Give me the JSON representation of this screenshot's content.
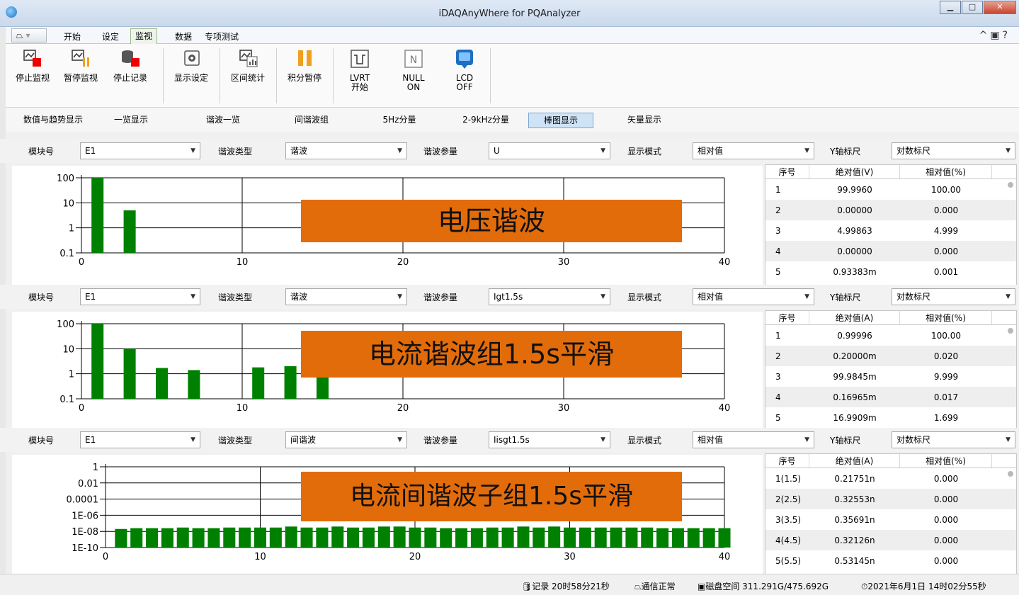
{
  "window": {
    "title": "iDAQAnyWhere for PQAnalyzer"
  },
  "ribbon": {
    "tabs": [
      "开始",
      "设定",
      "监视",
      "数据",
      "专项测试"
    ],
    "active_tab": "监视"
  },
  "toolbar": {
    "stop_monitor": "停止监视",
    "pause_monitor": "暂停监视",
    "stop_record": "停止记录",
    "display_settings": "显示设定",
    "interval_stats": "区间统计",
    "integral_pause": "积分暂停",
    "lvrt_line1": "LVRT",
    "lvrt_line2": "开始",
    "null_line1": "NULL",
    "null_line2": "ON",
    "lcd_line1": "LCD",
    "lcd_line2": "OFF",
    "null_icon_text": "N"
  },
  "subtabs": [
    "数值与趋势显示",
    "一览显示",
    "谐波一览",
    "间谐波组",
    "5Hz分量",
    "2-9kHz分量",
    "棒图显示",
    "矢量显示"
  ],
  "active_subtab": "棒图显示",
  "panels": [
    {
      "controls": {
        "module_label": "模块号",
        "module_value": "E1",
        "type_label": "谐波类型",
        "type_value": "谐波",
        "param_label": "谐波参量",
        "param_value": "U",
        "mode_label": "显示模式",
        "mode_value": "相对值",
        "yscale_label": "Y轴标尺",
        "yscale_value": "对数标尺"
      },
      "overlay": "电压谐波",
      "table": {
        "headers": [
          "序号",
          "绝对值(V)",
          "相对值(%)"
        ],
        "rows": [
          [
            "1",
            "99.9960",
            "100.00"
          ],
          [
            "2",
            "0.00000",
            "0.000"
          ],
          [
            "3",
            "4.99863",
            "4.999"
          ],
          [
            "4",
            "0.00000",
            "0.000"
          ],
          [
            "5",
            "0.93383m",
            "0.001"
          ]
        ]
      }
    },
    {
      "controls": {
        "module_label": "模块号",
        "module_value": "E1",
        "type_label": "谐波类型",
        "type_value": "谐波",
        "param_label": "谐波参量",
        "param_value": "Igt1.5s",
        "mode_label": "显示模式",
        "mode_value": "相对值",
        "yscale_label": "Y轴标尺",
        "yscale_value": "对数标尺"
      },
      "overlay": "电流谐波组1.5s平滑",
      "table": {
        "headers": [
          "序号",
          "绝对值(A)",
          "相对值(%)"
        ],
        "rows": [
          [
            "1",
            "0.99996",
            "100.00"
          ],
          [
            "2",
            "0.20000m",
            "0.020"
          ],
          [
            "3",
            "99.9845m",
            "9.999"
          ],
          [
            "4",
            "0.16965m",
            "0.017"
          ],
          [
            "5",
            "16.9909m",
            "1.699"
          ]
        ]
      }
    },
    {
      "controls": {
        "module_label": "模块号",
        "module_value": "E1",
        "type_label": "谐波类型",
        "type_value": "间谐波",
        "param_label": "谐波参量",
        "param_value": "Iisgt1.5s",
        "mode_label": "显示模式",
        "mode_value": "相对值",
        "yscale_label": "Y轴标尺",
        "yscale_value": "对数标尺"
      },
      "overlay": "电流间谐波子组1.5s平滑",
      "table": {
        "headers": [
          "序号",
          "绝对值(A)",
          "相对值(%)"
        ],
        "rows": [
          [
            "1(1.5)",
            "0.21751n",
            "0.000"
          ],
          [
            "2(2.5)",
            "0.32553n",
            "0.000"
          ],
          [
            "3(3.5)",
            "0.35691n",
            "0.000"
          ],
          [
            "4(4.5)",
            "0.32126n",
            "0.000"
          ],
          [
            "5(5.5)",
            "0.53145n",
            "0.000"
          ]
        ]
      }
    }
  ],
  "chart_data": [
    {
      "type": "bar",
      "x": [
        1,
        3
      ],
      "values": [
        100,
        5
      ],
      "yscale": "log",
      "ylim": [
        0.1,
        100
      ],
      "xlim": [
        0,
        40
      ],
      "yticks": [
        "100",
        "10",
        "1",
        "0.1"
      ],
      "xticks": [
        "0",
        "10",
        "20",
        "30",
        "40"
      ],
      "color": "#008000"
    },
    {
      "type": "bar",
      "x": [
        1,
        3,
        5,
        7,
        11,
        13,
        15
      ],
      "values": [
        100,
        10,
        1.7,
        1.4,
        1.8,
        2.0,
        0.8
      ],
      "yscale": "log",
      "ylim": [
        0.1,
        100
      ],
      "xlim": [
        0,
        40
      ],
      "yticks": [
        "100",
        "10",
        "1",
        "0.1"
      ],
      "xticks": [
        "0",
        "10",
        "20",
        "30",
        "40"
      ],
      "color": "#008000"
    },
    {
      "type": "bar",
      "x": [
        1,
        2,
        3,
        4,
        5,
        6,
        7,
        8,
        9,
        10,
        11,
        12,
        13,
        14,
        15,
        16,
        17,
        18,
        19,
        20,
        21,
        22,
        23,
        24,
        25,
        26,
        27,
        28,
        29,
        30,
        31,
        32,
        33,
        34,
        35,
        36,
        37,
        38,
        39,
        40
      ],
      "values": [
        2e-08,
        2.5e-08,
        2.5e-08,
        2.5e-08,
        3e-08,
        2.5e-08,
        2.5e-08,
        3e-08,
        3e-08,
        3e-08,
        3e-08,
        4e-08,
        3e-08,
        3e-08,
        4e-08,
        3e-08,
        3e-08,
        4e-08,
        4e-08,
        3e-08,
        3e-08,
        2.5e-08,
        2.5e-08,
        2.5e-08,
        3e-08,
        3e-08,
        4e-08,
        3e-08,
        4e-08,
        3e-08,
        3e-08,
        3e-08,
        3e-08,
        3e-08,
        3e-08,
        2.5e-08,
        2.5e-08,
        2.5e-08,
        2.5e-08,
        2.5e-08
      ],
      "yscale": "log",
      "ylim": [
        1e-10,
        1
      ],
      "xlim": [
        0,
        40
      ],
      "yticks": [
        "1",
        "0.01",
        "0.0001",
        "1E-06",
        "1E-08",
        "1E-10"
      ],
      "xticks": [
        "0",
        "10",
        "20",
        "30",
        "40"
      ],
      "color": "#008000"
    }
  ],
  "status": {
    "record": "记录 20时58分21秒",
    "comm": "通信正常",
    "disk": "磁盘空间 311.291G/475.692G",
    "datetime": "2021年6月1日 14时02分55秒"
  }
}
